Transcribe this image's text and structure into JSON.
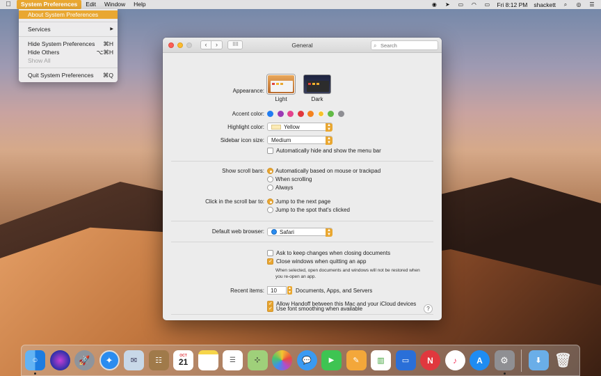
{
  "menubar": {
    "apple": "",
    "app_name": "System Preferences",
    "items": [
      "Edit",
      "Window",
      "Help"
    ],
    "clock": "Fri 8:12 PM",
    "user": "shackett"
  },
  "dropdown": {
    "about": "About System Preferences",
    "services": "Services",
    "services_arrow": "▶",
    "hide": "Hide System Preferences",
    "hide_shortcut": "⌘H",
    "hide_others": "Hide Others",
    "hide_others_shortcut": "⌥⌘H",
    "show_all": "Show All",
    "quit": "Quit System Preferences",
    "quit_shortcut": "⌘Q"
  },
  "window": {
    "title": "General",
    "search_placeholder": "Search"
  },
  "general": {
    "appearance_label": "Appearance:",
    "appearance_light": "Light",
    "appearance_dark": "Dark",
    "accent_label": "Accent color:",
    "accent_colors": [
      "#1f7cf2",
      "#9b3bb5",
      "#e4448e",
      "#e0383e",
      "#f4821f",
      "#f7c12b",
      "#62ba46",
      "#8e8e93"
    ],
    "highlight_label": "Highlight color:",
    "highlight_value": "Yellow",
    "sidebar_label": "Sidebar icon size:",
    "sidebar_value": "Medium",
    "autohide_menu": "Automatically hide and show the menu bar",
    "scroll_label": "Show scroll bars:",
    "scroll_auto": "Automatically based on mouse or trackpad",
    "scroll_when": "When scrolling",
    "scroll_always": "Always",
    "click_label": "Click in the scroll bar to:",
    "click_next": "Jump to the next page",
    "click_spot": "Jump to the spot that's clicked",
    "browser_label": "Default web browser:",
    "browser_value": "Safari",
    "ask_keep": "Ask to keep changes when closing documents",
    "close_windows": "Close windows when quitting an app",
    "close_note": "When selected, open documents and windows will not be restored when you re-open an app.",
    "recent_label": "Recent items:",
    "recent_value": "10",
    "recent_suffix": "Documents, Apps, and Servers",
    "handoff": "Allow Handoff between this Mac and your iCloud devices",
    "font_smoothing": "Use font smoothing when available",
    "help": "?"
  },
  "dock": {
    "calendar_day": "21",
    "calendar_month": "OCT"
  }
}
